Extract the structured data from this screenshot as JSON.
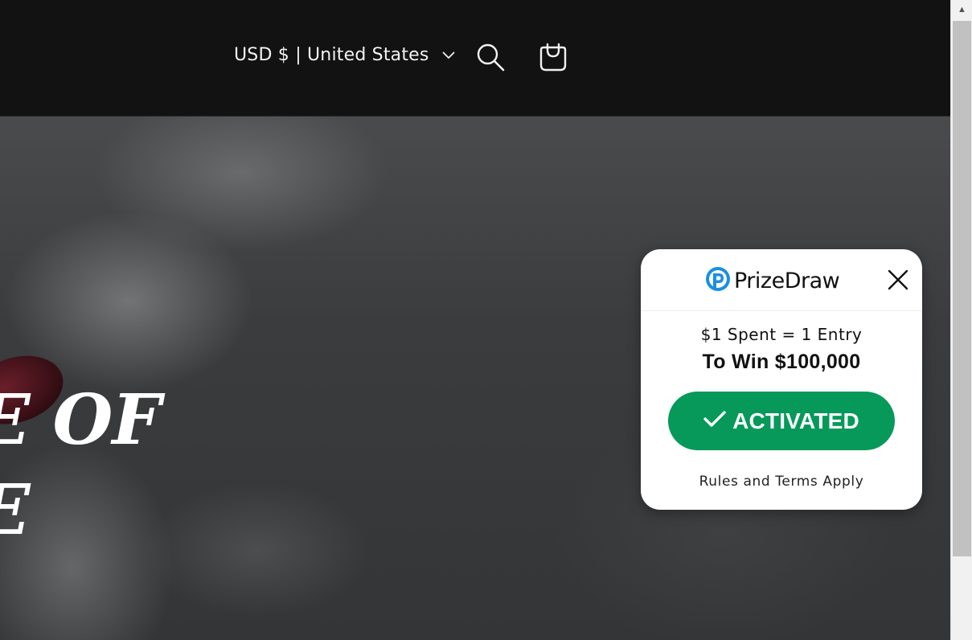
{
  "header": {
    "currency_selector": "USD $ | United States",
    "icons": {
      "dropdown": "chevron-down-icon",
      "search": "search-icon",
      "cart": "cart-icon"
    }
  },
  "hero": {
    "title_text": "E OF\nE"
  },
  "prize_draw": {
    "brand": "PrizeDraw",
    "brand_color": "#1a8fe3",
    "entry_text": "$1 Spent = 1 Entry",
    "win_text": "To Win $100,000",
    "button_label": "ACTIVATED",
    "button_color": "#06995a",
    "rules_text": "Rules and Terms Apply",
    "icons": {
      "logo": "prizedraw-logo-icon",
      "close": "close-icon",
      "check": "checkmark-icon"
    }
  },
  "colors": {
    "header_bg": "#121212",
    "card_bg": "#ffffff"
  }
}
